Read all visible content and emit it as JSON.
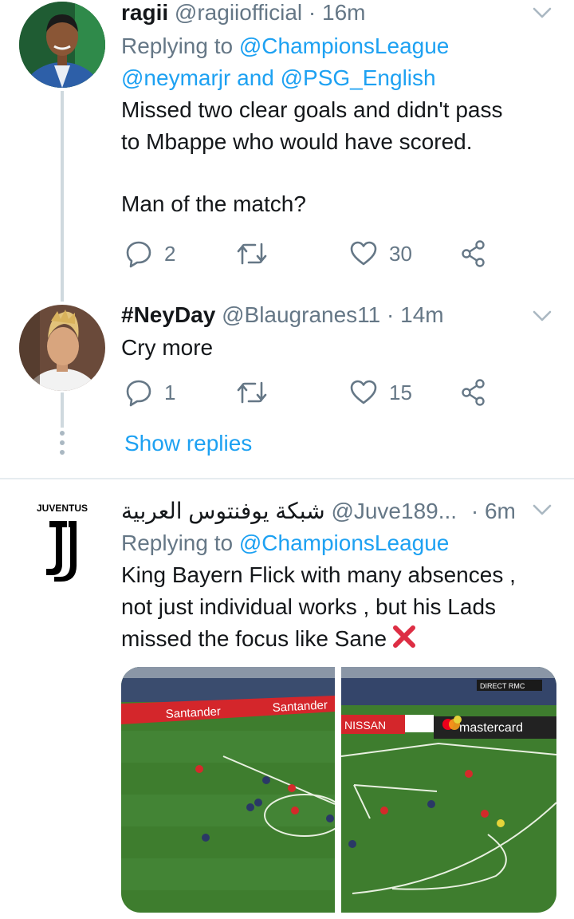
{
  "tweets": [
    {
      "name": "ragii",
      "handle": "@ragiiofficial",
      "sep": "·",
      "time": "16m",
      "replying_prefix": "Replying to",
      "replying_handles": [
        "@ChampionsLeague",
        "@neymarjr",
        "@PSG_English"
      ],
      "replying_and": "and",
      "text_lines": [
        "Missed two clear goals and didn't pass",
        "to Mbappe who would have scored.",
        "",
        "Man of the match?"
      ],
      "replies": "2",
      "retweets": "",
      "likes": "30"
    },
    {
      "name": "#NeyDay",
      "handle": "@Blaugranes11",
      "sep": "·",
      "time": "14m",
      "text": "Cry more",
      "replies": "1",
      "retweets": "",
      "likes": "15"
    },
    {
      "name": "شبكة يوفنتوس العربية",
      "handle": "@Juve189...",
      "sep": "·",
      "time": "6m",
      "avatar_text": "JUVENTUS",
      "replying_prefix": "Replying to",
      "replying_handles": [
        "@ChampionsLeague"
      ],
      "text_lines": [
        "King Bayern Flick with many absences ,",
        "not just individual works , but his Lads",
        "missed the focus like Sane"
      ],
      "media_text": {
        "left_banner_1": "Santander",
        "left_banner_2": "Santander",
        "right_banner_1": "NISSAN",
        "right_banner_2": "mastercard",
        "right_tv": "DIRECT RMC"
      }
    }
  ],
  "show_replies": "Show replies",
  "colors": {
    "link": "#1da1f2",
    "muted": "#657786",
    "text": "#14171a",
    "pitch": "#3e7d2e",
    "banner_red": "#d4262b"
  }
}
